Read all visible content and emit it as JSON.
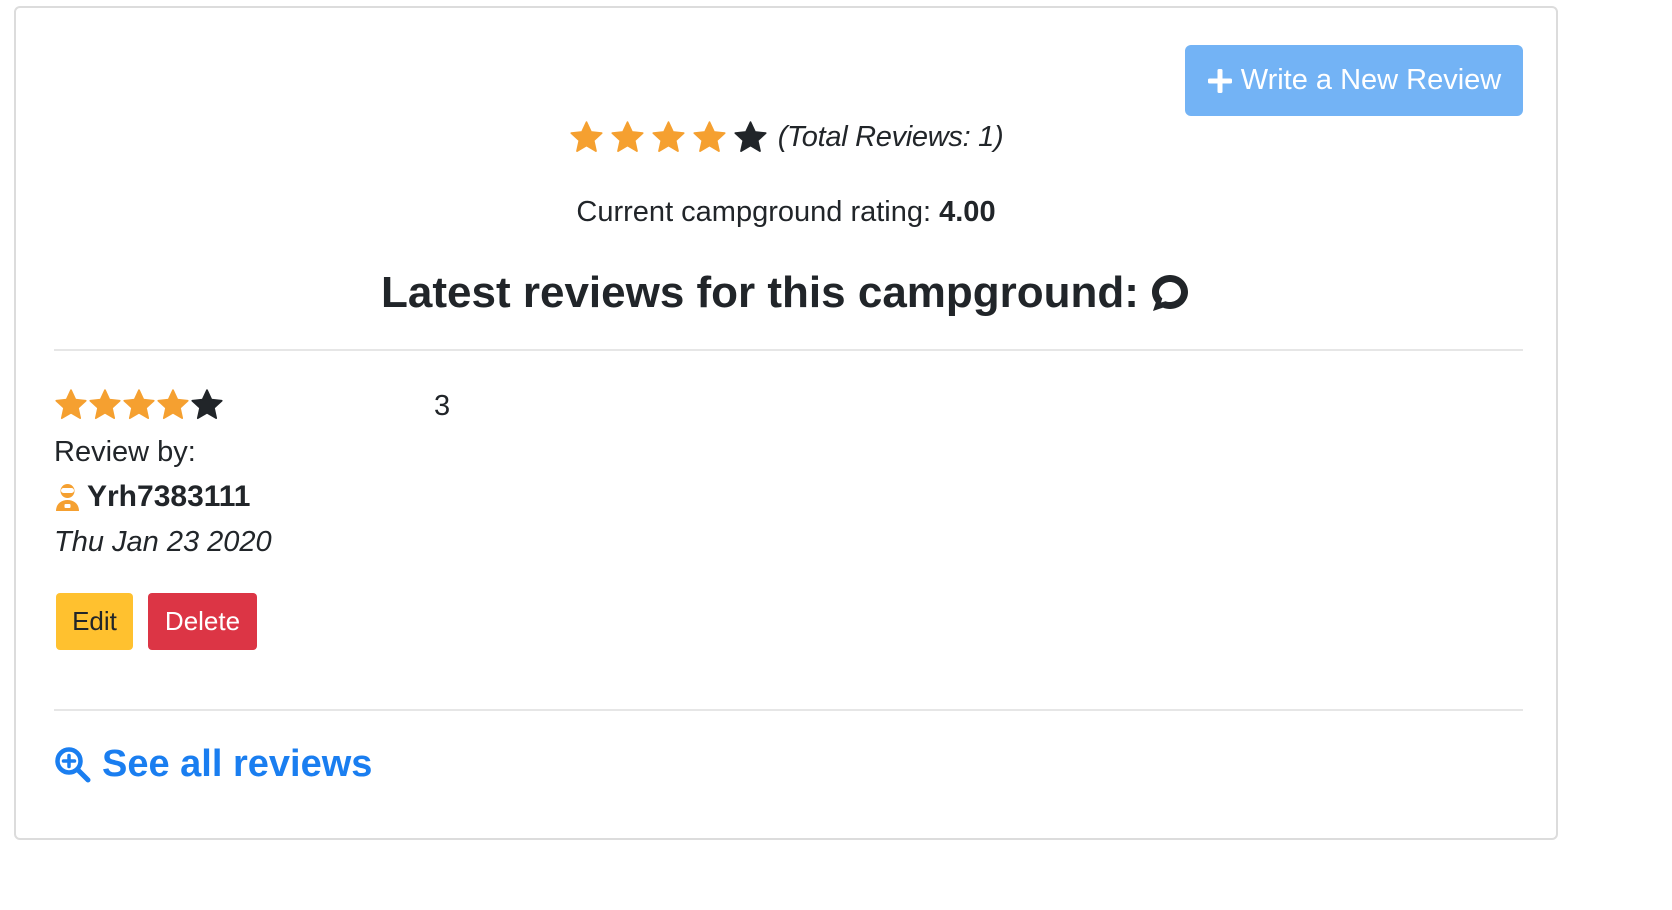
{
  "header": {
    "write_review_label": "Write a New Review",
    "write_review_color": "#73b3f5"
  },
  "summary": {
    "stars_filled": 4,
    "stars_total": 5,
    "total_reviews_text": "(Total Reviews: 1)",
    "rating_label": "Current campground rating:",
    "rating_value": "4.00"
  },
  "latest": {
    "heading": "Latest reviews for this campground:",
    "icon": "chat-bubble-icon"
  },
  "review": {
    "stars_filled": 4,
    "stars_total": 5,
    "text": "3",
    "by_label": "Review by:",
    "author": "Yrh7383111",
    "author_icon": "user-icon",
    "date": "Thu Jan 23 2020",
    "edit_label": "Edit",
    "delete_label": "Delete"
  },
  "footer": {
    "see_all_label": "See all reviews",
    "see_all_icon": "zoom-in-icon"
  },
  "colors": {
    "star_filled": "#f5a030",
    "star_empty": "#212529",
    "edit": "#ffc12f",
    "delete": "#dc3545",
    "link": "#1a7ef0"
  }
}
